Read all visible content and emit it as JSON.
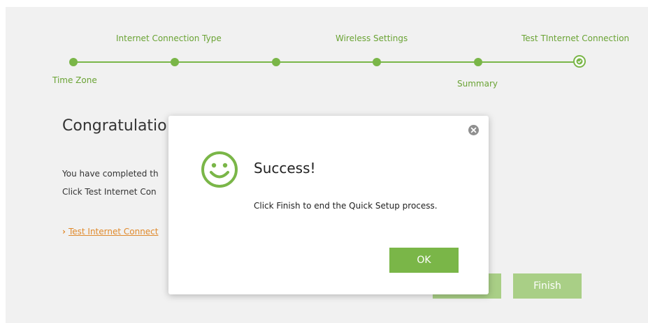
{
  "wizard": {
    "steps": [
      {
        "label": "Time Zone"
      },
      {
        "label": "Internet Connection Type"
      },
      {
        "label": "Wireless Settings"
      },
      {
        "label": "Summary"
      },
      {
        "label": "Test TInternet Connection"
      }
    ],
    "accent_color": "#7ab648"
  },
  "main": {
    "title": "Congratulatio",
    "line1": "You have completed th",
    "line2": "Click Test Internet Con",
    "test_link": "Test Internet Connect",
    "back_label": "",
    "finish_label": "Finish"
  },
  "modal": {
    "icon": "smiley-icon",
    "title": "Success!",
    "message": "Click Finish to end the Quick Setup process.",
    "ok_label": "OK",
    "close_icon": "close-icon"
  }
}
